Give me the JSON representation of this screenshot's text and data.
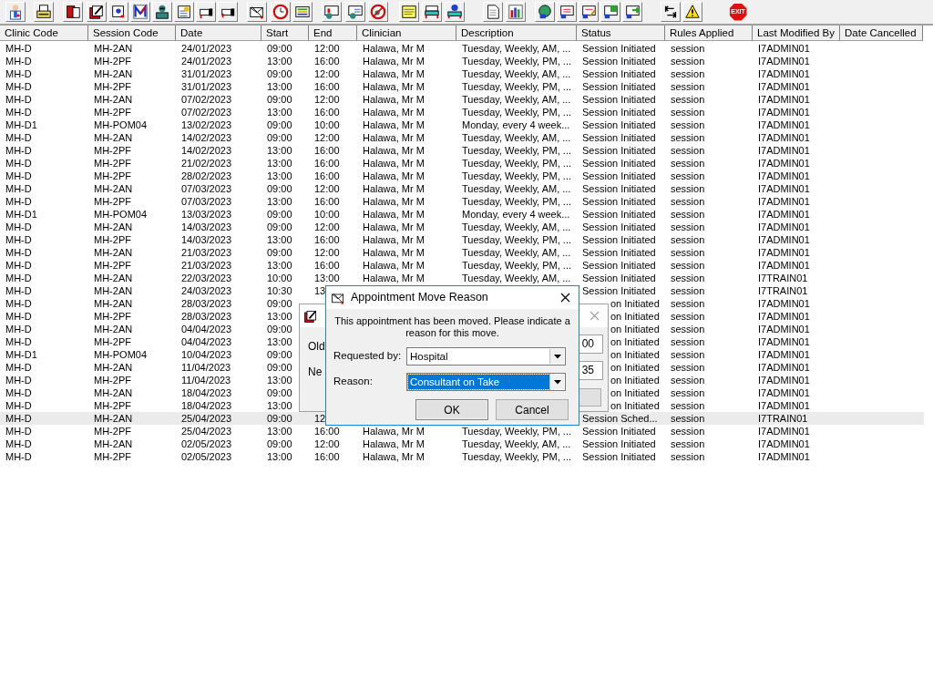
{
  "toolbar": {
    "exit_label": "EXIT"
  },
  "table": {
    "columns": [
      "Clinic Code",
      "Session Code",
      "Date",
      "Start",
      "End",
      "Clinician",
      "Description",
      "Status",
      "Rules Applied",
      "Last Modified By",
      "Date Cancelled"
    ],
    "rows": [
      {
        "selected": false,
        "clinic": "MH-D",
        "session": "MH-2AN",
        "date": "24/01/2023",
        "start": "09:00",
        "end": "12:00",
        "clinician": "Halawa, Mr M",
        "description": "Tuesday, Weekly, AM, ...",
        "status": "Session Initiated",
        "rules": "session",
        "modified_by": "I7ADMIN01"
      },
      {
        "selected": false,
        "clinic": "MH-D",
        "session": "MH-2PF",
        "date": "24/01/2023",
        "start": "13:00",
        "end": "16:00",
        "clinician": "Halawa, Mr M",
        "description": "Tuesday, Weekly, PM, ...",
        "status": "Session Initiated",
        "rules": "session",
        "modified_by": "I7ADMIN01"
      },
      {
        "selected": false,
        "clinic": "MH-D",
        "session": "MH-2AN",
        "date": "31/01/2023",
        "start": "09:00",
        "end": "12:00",
        "clinician": "Halawa, Mr M",
        "description": "Tuesday, Weekly, AM, ...",
        "status": "Session Initiated",
        "rules": "session",
        "modified_by": "I7ADMIN01"
      },
      {
        "selected": false,
        "clinic": "MH-D",
        "session": "MH-2PF",
        "date": "31/01/2023",
        "start": "13:00",
        "end": "16:00",
        "clinician": "Halawa, Mr M",
        "description": "Tuesday, Weekly, PM, ...",
        "status": "Session Initiated",
        "rules": "session",
        "modified_by": "I7ADMIN01"
      },
      {
        "selected": false,
        "clinic": "MH-D",
        "session": "MH-2AN",
        "date": "07/02/2023",
        "start": "09:00",
        "end": "12:00",
        "clinician": "Halawa, Mr M",
        "description": "Tuesday, Weekly, AM, ...",
        "status": "Session Initiated",
        "rules": "session",
        "modified_by": "I7ADMIN01"
      },
      {
        "selected": false,
        "clinic": "MH-D",
        "session": "MH-2PF",
        "date": "07/02/2023",
        "start": "13:00",
        "end": "16:00",
        "clinician": "Halawa, Mr M",
        "description": "Tuesday, Weekly, PM, ...",
        "status": "Session Initiated",
        "rules": "session",
        "modified_by": "I7ADMIN01"
      },
      {
        "selected": false,
        "clinic": "MH-D1",
        "session": "MH-POM04",
        "date": "13/02/2023",
        "start": "09:00",
        "end": "10:00",
        "clinician": "Halawa, Mr M",
        "description": "Monday, every 4 week...",
        "status": "Session Initiated",
        "rules": "session",
        "modified_by": "I7ADMIN01"
      },
      {
        "selected": false,
        "clinic": "MH-D",
        "session": "MH-2AN",
        "date": "14/02/2023",
        "start": "09:00",
        "end": "12:00",
        "clinician": "Halawa, Mr M",
        "description": "Tuesday, Weekly, AM, ...",
        "status": "Session Initiated",
        "rules": "session",
        "modified_by": "I7ADMIN01"
      },
      {
        "selected": false,
        "clinic": "MH-D",
        "session": "MH-2PF",
        "date": "14/02/2023",
        "start": "13:00",
        "end": "16:00",
        "clinician": "Halawa, Mr M",
        "description": "Tuesday, Weekly, PM, ...",
        "status": "Session Initiated",
        "rules": "session",
        "modified_by": "I7ADMIN01"
      },
      {
        "selected": false,
        "clinic": "MH-D",
        "session": "MH-2PF",
        "date": "21/02/2023",
        "start": "13:00",
        "end": "16:00",
        "clinician": "Halawa, Mr M",
        "description": "Tuesday, Weekly, PM, ...",
        "status": "Session Initiated",
        "rules": "session",
        "modified_by": "I7ADMIN01"
      },
      {
        "selected": false,
        "clinic": "MH-D",
        "session": "MH-2PF",
        "date": "28/02/2023",
        "start": "13:00",
        "end": "16:00",
        "clinician": "Halawa, Mr M",
        "description": "Tuesday, Weekly, PM, ...",
        "status": "Session Initiated",
        "rules": "session",
        "modified_by": "I7ADMIN01"
      },
      {
        "selected": false,
        "clinic": "MH-D",
        "session": "MH-2AN",
        "date": "07/03/2023",
        "start": "09:00",
        "end": "12:00",
        "clinician": "Halawa, Mr M",
        "description": "Tuesday, Weekly, AM, ...",
        "status": "Session Initiated",
        "rules": "session",
        "modified_by": "I7ADMIN01"
      },
      {
        "selected": false,
        "clinic": "MH-D",
        "session": "MH-2PF",
        "date": "07/03/2023",
        "start": "13:00",
        "end": "16:00",
        "clinician": "Halawa, Mr M",
        "description": "Tuesday, Weekly, PM, ...",
        "status": "Session Initiated",
        "rules": "session",
        "modified_by": "I7ADMIN01"
      },
      {
        "selected": false,
        "clinic": "MH-D1",
        "session": "MH-POM04",
        "date": "13/03/2023",
        "start": "09:00",
        "end": "10:00",
        "clinician": "Halawa, Mr M",
        "description": "Monday, every 4 week...",
        "status": "Session Initiated",
        "rules": "session",
        "modified_by": "I7ADMIN01"
      },
      {
        "selected": false,
        "clinic": "MH-D",
        "session": "MH-2AN",
        "date": "14/03/2023",
        "start": "09:00",
        "end": "12:00",
        "clinician": "Halawa, Mr M",
        "description": "Tuesday, Weekly, AM, ...",
        "status": "Session Initiated",
        "rules": "session",
        "modified_by": "I7ADMIN01"
      },
      {
        "selected": false,
        "clinic": "MH-D",
        "session": "MH-2PF",
        "date": "14/03/2023",
        "start": "13:00",
        "end": "16:00",
        "clinician": "Halawa, Mr M",
        "description": "Tuesday, Weekly, PM, ...",
        "status": "Session Initiated",
        "rules": "session",
        "modified_by": "I7ADMIN01"
      },
      {
        "selected": false,
        "clinic": "MH-D",
        "session": "MH-2AN",
        "date": "21/03/2023",
        "start": "09:00",
        "end": "12:00",
        "clinician": "Halawa, Mr M",
        "description": "Tuesday, Weekly, AM, ...",
        "status": "Session Initiated",
        "rules": "session",
        "modified_by": "I7ADMIN01"
      },
      {
        "selected": false,
        "clinic": "MH-D",
        "session": "MH-2PF",
        "date": "21/03/2023",
        "start": "13:00",
        "end": "16:00",
        "clinician": "Halawa, Mr M",
        "description": "Tuesday, Weekly, PM, ...",
        "status": "Session Initiated",
        "rules": "session",
        "modified_by": "I7ADMIN01"
      },
      {
        "selected": false,
        "clinic": "MH-D",
        "session": "MH-2AN",
        "date": "22/03/2023",
        "start": "10:00",
        "end": "13:00",
        "clinician": "Halawa, Mr M",
        "description": "Tuesday, Weekly, AM, ...",
        "status": "Session Initiated",
        "rules": "session",
        "modified_by": "I7TRAIN01"
      },
      {
        "selected": false,
        "clinic": "MH-D",
        "session": "MH-2AN",
        "date": "24/03/2023",
        "start": "10:30",
        "end": "13",
        "status": "Session Initiated",
        "rules": "session",
        "modified_by": "I7TRAIN01"
      },
      {
        "selected": false,
        "clinic": "MH-D",
        "session": "MH-2AN",
        "date": "28/03/2023",
        "start": "09:00",
        "status": "on Initiated",
        "status_cut": true,
        "rules": "session",
        "modified_by": "I7ADMIN01"
      },
      {
        "selected": false,
        "clinic": "MH-D",
        "session": "MH-2PF",
        "date": "28/03/2023",
        "start": "13:00",
        "status": "on Initiated",
        "status_cut": true,
        "rules": "session",
        "modified_by": "I7ADMIN01"
      },
      {
        "selected": false,
        "clinic": "MH-D",
        "session": "MH-2AN",
        "date": "04/04/2023",
        "start": "09:00",
        "status": "on Initiated",
        "status_cut": true,
        "rules": "session",
        "modified_by": "I7ADMIN01"
      },
      {
        "selected": false,
        "clinic": "MH-D",
        "session": "MH-2PF",
        "date": "04/04/2023",
        "start": "13:00",
        "status": "on Initiated",
        "status_cut": true,
        "rules": "session",
        "modified_by": "I7ADMIN01"
      },
      {
        "selected": false,
        "clinic": "MH-D1",
        "session": "MH-POM04",
        "date": "10/04/2023",
        "start": "09:00",
        "status": "on Initiated",
        "status_cut": true,
        "rules": "session",
        "modified_by": "I7ADMIN01"
      },
      {
        "selected": false,
        "clinic": "MH-D",
        "session": "MH-2AN",
        "date": "11/04/2023",
        "start": "09:00",
        "status": "on Initiated",
        "status_cut": true,
        "rules": "session",
        "modified_by": "I7ADMIN01"
      },
      {
        "selected": false,
        "clinic": "MH-D",
        "session": "MH-2PF",
        "date": "11/04/2023",
        "start": "13:00",
        "status": "on Initiated",
        "status_cut": true,
        "rules": "session",
        "modified_by": "I7ADMIN01"
      },
      {
        "selected": false,
        "clinic": "MH-D",
        "session": "MH-2AN",
        "date": "18/04/2023",
        "start": "09:00",
        "status": "on Initiated",
        "status_cut": true,
        "rules": "session",
        "modified_by": "I7ADMIN01"
      },
      {
        "selected": false,
        "clinic": "MH-D",
        "session": "MH-2PF",
        "date": "18/04/2023",
        "start": "13:00",
        "status": "on Initiated",
        "status_cut": true,
        "rules": "session",
        "modified_by": "I7ADMIN01"
      },
      {
        "selected": true,
        "clinic": "MH-D",
        "session": "MH-2AN",
        "date": "25/04/2023",
        "start": "09:00",
        "end": "12",
        "status": "Session Sched...",
        "rules": "session",
        "modified_by": "I7TRAIN01"
      },
      {
        "selected": false,
        "clinic": "MH-D",
        "session": "MH-2PF",
        "date": "25/04/2023",
        "start": "13:00",
        "end": "16:00",
        "clinician": "Halawa, Mr M",
        "description": "Tuesday, Weekly, PM, ...",
        "status": "Session Initiated",
        "rules": "session",
        "modified_by": "I7ADMIN01"
      },
      {
        "selected": false,
        "clinic": "MH-D",
        "session": "MH-2AN",
        "date": "02/05/2023",
        "start": "09:00",
        "end": "12:00",
        "clinician": "Halawa, Mr M",
        "description": "Tuesday, Weekly, AM, ...",
        "status": "Session Initiated",
        "rules": "session",
        "modified_by": "I7ADMIN01"
      },
      {
        "selected": false,
        "clinic": "MH-D",
        "session": "MH-2PF",
        "date": "02/05/2023",
        "start": "13:00",
        "end": "16:00",
        "clinician": "Halawa, Mr M",
        "description": "Tuesday, Weekly, PM, ...",
        "status": "Session Initiated",
        "rules": "session",
        "modified_by": "I7ADMIN01"
      }
    ]
  },
  "back_dialog": {
    "labels": [
      "Old",
      "Ne"
    ],
    "fields": [
      "00",
      "35"
    ]
  },
  "move_reason_dialog": {
    "title": "Appointment Move Reason",
    "message": "This appointment has been moved. Please indicate a reason for this move.",
    "fields": [
      {
        "label": "Requested by:",
        "value": "Hospital",
        "selected": false
      },
      {
        "label": "Reason:",
        "value": "Consultant on Take",
        "selected": true
      }
    ],
    "buttons": [
      "OK",
      "Cancel"
    ]
  }
}
